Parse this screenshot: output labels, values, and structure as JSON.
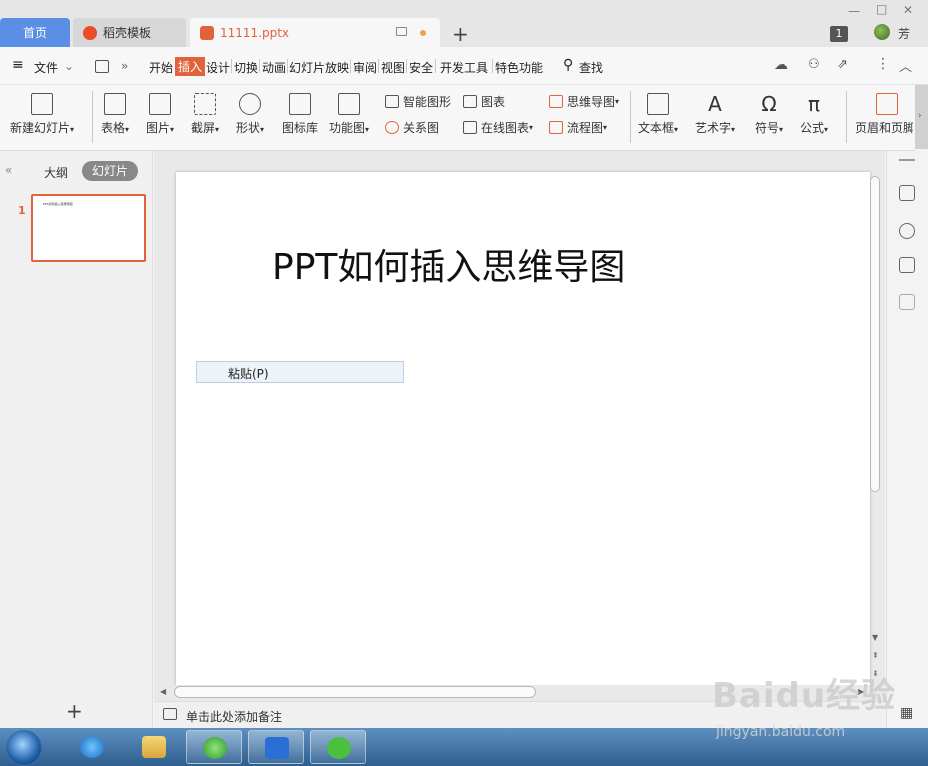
{
  "tabs": {
    "home": "首页",
    "template": "稻壳模板",
    "file": "11111.pptx",
    "add": "+"
  },
  "window": {
    "badge_count": "1",
    "user_name": "芳",
    "minimize": "—",
    "maximize": "□",
    "close": "✕"
  },
  "menu": {
    "file": "文件",
    "items": [
      "开始",
      "插入",
      "设计",
      "切换",
      "动画",
      "幻灯片放映",
      "审阅",
      "视图",
      "安全",
      "开发工具",
      "特色功能"
    ],
    "search": "查找",
    "active": "插入"
  },
  "ribbon": {
    "new_slide": "新建幻灯片",
    "table": "表格",
    "picture": "图片",
    "screenshot": "截屏",
    "shape": "形状",
    "icon_lib": "图标库",
    "function_chart": "功能图",
    "smart_art": "智能图形",
    "chart": "图表",
    "relation": "关系图",
    "online_chart": "在线图表",
    "mind_map": "思维导图",
    "flowchart": "流程图",
    "textbox": "文本框",
    "wordart": "艺术字",
    "symbol": "符号",
    "formula": "公式",
    "header_footer": "页眉和页脚"
  },
  "left_panel": {
    "outline_tab": "大纲",
    "slides_tab": "幻灯片",
    "slide_number": "1",
    "thumb_title": "PPT如何插入思维导图",
    "add_slide": "+"
  },
  "slide": {
    "title": "PPT如何插入思维导图"
  },
  "context_menu": {
    "paste": "粘贴(P)"
  },
  "notes": {
    "placeholder": "单击此处添加备注"
  },
  "watermark": {
    "brand": "Baidu经验",
    "url": "jingyan.baidu.com"
  },
  "colors": {
    "accent": "#e0633b",
    "home_tab": "#5b8fe6",
    "taskbar": "#2f5f8f"
  }
}
